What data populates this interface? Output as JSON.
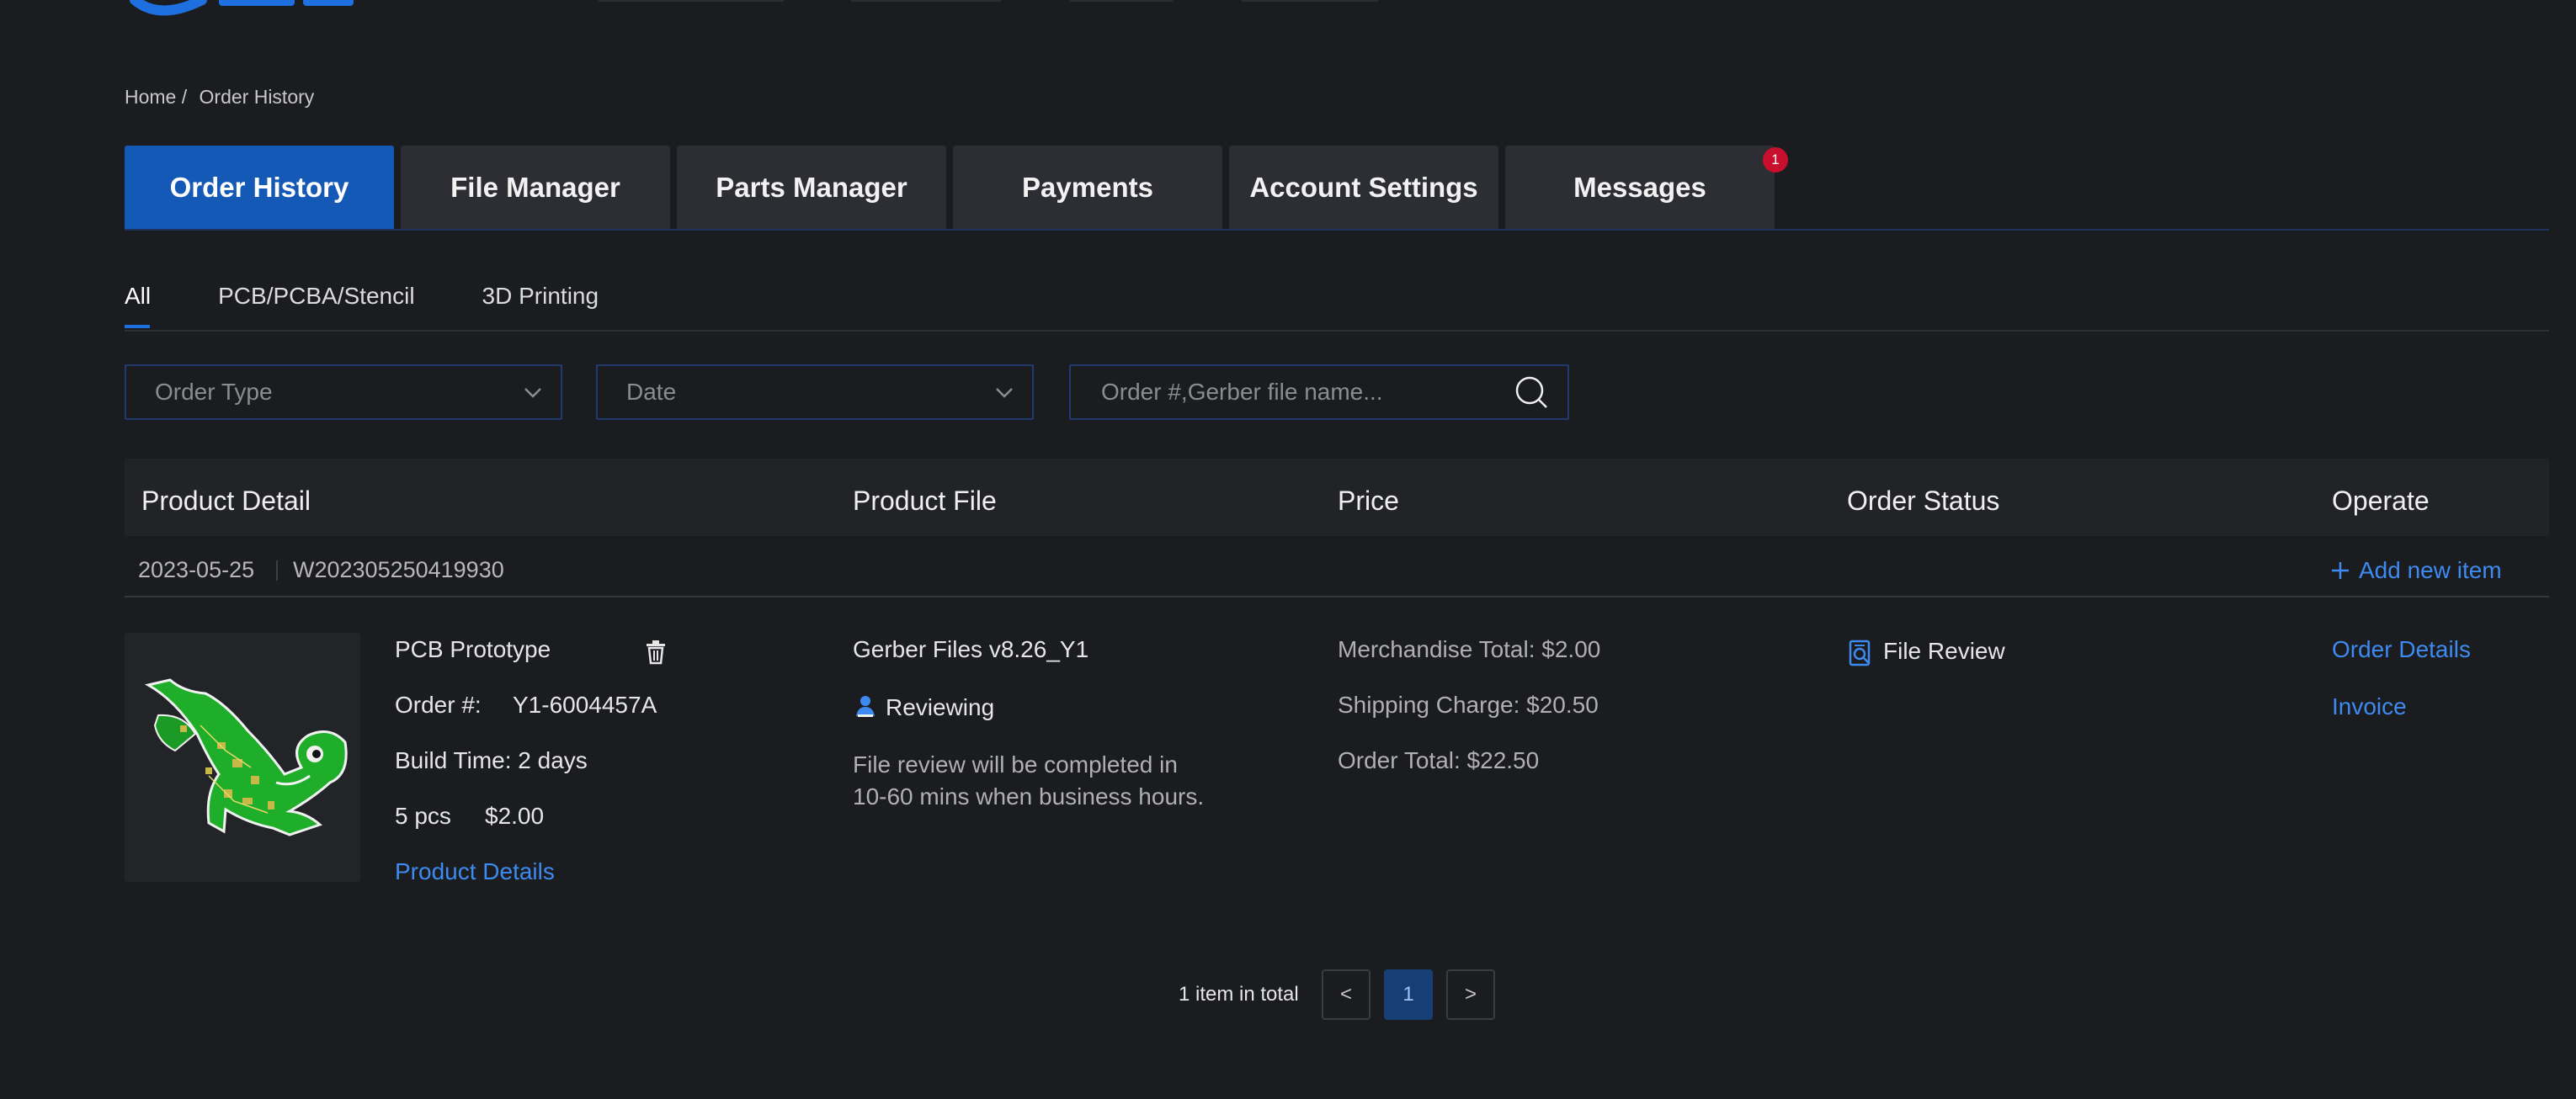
{
  "colors": {
    "accent": "#1559b7",
    "link": "#3d8bf0",
    "badge": "#c8102e",
    "background": "#1b1c1f"
  },
  "breadcrumb": {
    "home": "Home /",
    "current": "Order History"
  },
  "tabs": [
    {
      "label": "Order History",
      "active": true
    },
    {
      "label": "File Manager"
    },
    {
      "label": "Parts Manager"
    },
    {
      "label": "Payments"
    },
    {
      "label": "Account Settings"
    },
    {
      "label": "Messages",
      "badge": "1"
    }
  ],
  "subtabs": [
    {
      "label": "All",
      "active": true
    },
    {
      "label": "PCB/PCBA/Stencil"
    },
    {
      "label": "3D Printing"
    }
  ],
  "filters": {
    "order_type": "Order Type",
    "date": "Date",
    "search_placeholder": "Order #,Gerber file name..."
  },
  "table": {
    "headers": [
      "Product Detail",
      "Product File",
      "Price",
      "Order Status",
      "Operate"
    ],
    "order": {
      "date": "2023-05-25",
      "id": "W202305250419930",
      "add_item": "Add new item",
      "product": {
        "name": "PCB Prototype",
        "order_label": "Order #:",
        "order_no": "Y1-6004457A",
        "build_time": "Build Time: 2 days",
        "qty": "5 pcs",
        "price": "$2.00",
        "details_link": "Product Details"
      },
      "file": {
        "name": "Gerber Files v8.26_Y1",
        "status": "Reviewing",
        "note": "File review will be completed in 10-60 mins when business hours."
      },
      "pricing": {
        "merchandise": "Merchandise Total: $2.00",
        "shipping": "Shipping Charge: $20.50",
        "total": "Order Total: $22.50"
      },
      "status": "File Review",
      "operate": {
        "details": "Order Details",
        "invoice": "Invoice"
      }
    }
  },
  "pagination": {
    "total": "1 item in total",
    "prev": "<",
    "page": "1",
    "next": ">"
  }
}
